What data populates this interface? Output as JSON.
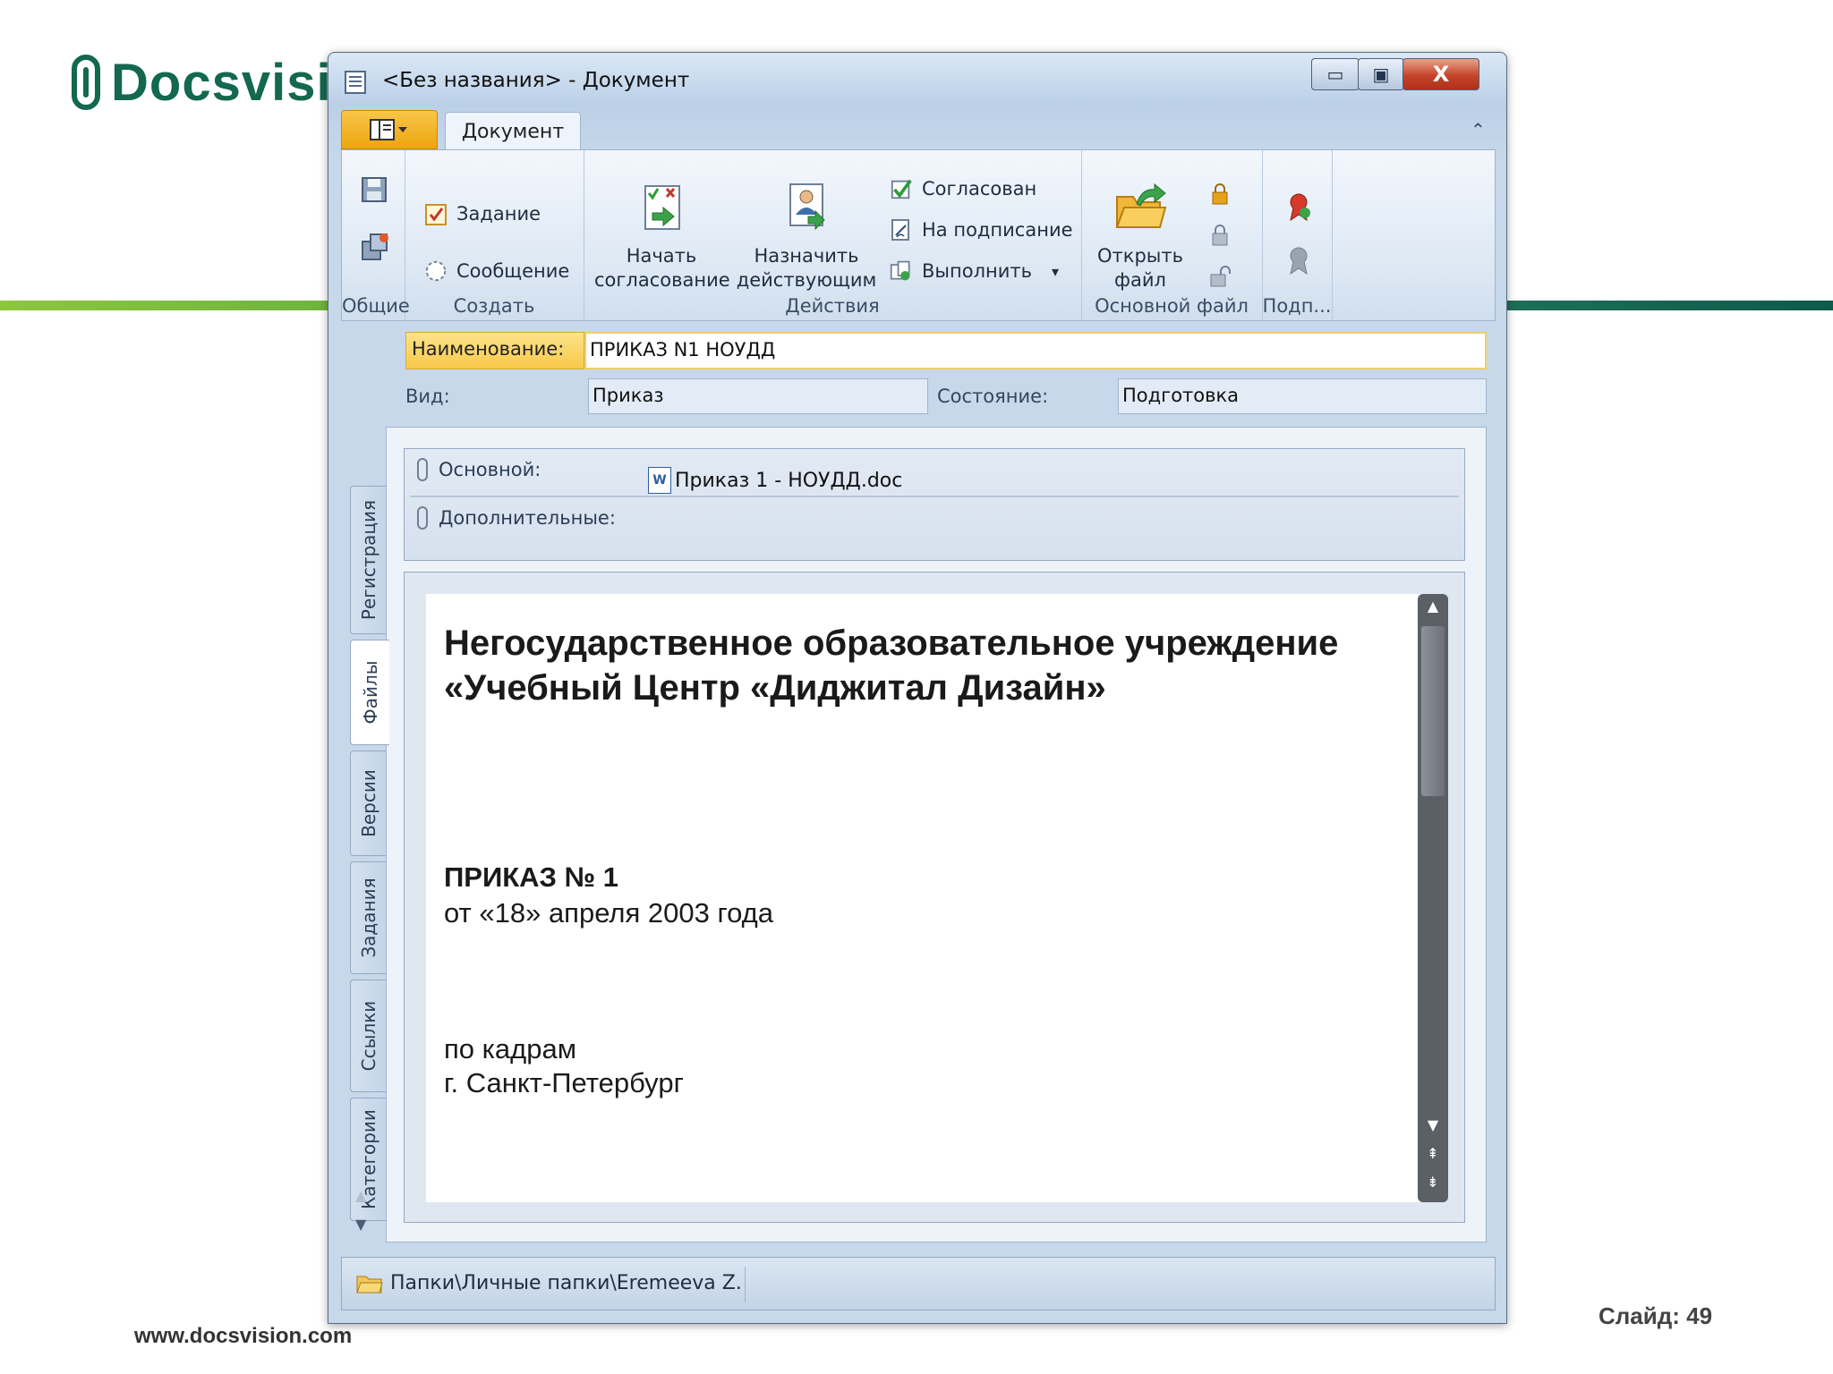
{
  "slide": {
    "logo_text": "Docsvisio",
    "footer_url": "www.docsvision.com",
    "slide_number": "Слайд: 49",
    "colors": {
      "brand_green": "#13684f",
      "line_left": "#8dc63f",
      "line_right": "#1e6f57"
    }
  },
  "window": {
    "title": "<Без названия> - Документ",
    "controls": {
      "minimize": "▭",
      "maximize": "▣",
      "close": "X"
    }
  },
  "ribbon": {
    "app_menu_icon": "app-menu-icon",
    "tabs": [
      {
        "label": "Документ",
        "active": true
      }
    ],
    "collapse_glyph": "⌃",
    "groups": {
      "general": {
        "label": "Общие"
      },
      "create": {
        "label": "Создать",
        "task": "Задание",
        "message": "Сообщение"
      },
      "actions": {
        "label": "Действия",
        "start_approval": [
          "Начать",
          "согласование"
        ],
        "assign_active": [
          "Назначить",
          "действующим"
        ],
        "approved": "Согласован",
        "to_sign": "На подписание",
        "execute": "Выполнить",
        "execute_dropdown": "▾"
      },
      "main_file": {
        "label": "Основной файл",
        "open_file": [
          "Открыть",
          "файл"
        ]
      },
      "signature": {
        "label": "Подп..."
      }
    }
  },
  "fields": {
    "name_label": "Наименование:",
    "name_value": "ПРИКАЗ N1 НОУДД",
    "kind_label": "Вид:",
    "kind_value": "Приказ",
    "state_label": "Состояние:",
    "state_value": "Подготовка"
  },
  "side_tabs": [
    "Регистрация",
    "Файлы",
    "Версии",
    "Задания",
    "Ссылки",
    "Категории"
  ],
  "side_tabs_active": "Файлы",
  "files": {
    "main_label": "Основной:",
    "main_file": "Приказ 1 - НОУДД.doc",
    "additional_label": "Дополнительные:"
  },
  "preview": {
    "heading_line1": "Негосударственное образовательное учреждение",
    "heading_line2": "«Учебный Центр «Диджитал Дизайн»",
    "order_title": "ПРИКАЗ № 1",
    "order_date": "от «18» апреля 2003 года",
    "topic": "по кадрам",
    "city": "г. Санкт-Петербург"
  },
  "status": {
    "path": "Папки\\Личные папки\\Eremeeva Z."
  }
}
